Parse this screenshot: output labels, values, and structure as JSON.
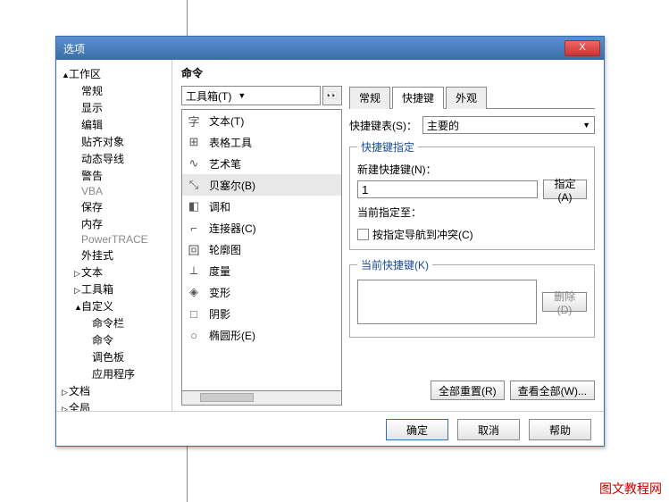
{
  "watermark": "图文教程网",
  "dialog": {
    "title": "选项",
    "close": "X",
    "tree": [
      {
        "label": "工作区",
        "indent": 0,
        "expand": "▲",
        "gray": false
      },
      {
        "label": "常规",
        "indent": 1,
        "gray": false
      },
      {
        "label": "显示",
        "indent": 1,
        "gray": false
      },
      {
        "label": "编辑",
        "indent": 1,
        "gray": false
      },
      {
        "label": "贴齐对象",
        "indent": 1,
        "gray": false
      },
      {
        "label": "动态导线",
        "indent": 1,
        "gray": false
      },
      {
        "label": "警告",
        "indent": 1,
        "gray": false
      },
      {
        "label": "VBA",
        "indent": 1,
        "gray": true
      },
      {
        "label": "保存",
        "indent": 1,
        "gray": false
      },
      {
        "label": "内存",
        "indent": 1,
        "gray": false
      },
      {
        "label": "PowerTRACE",
        "indent": 1,
        "gray": true
      },
      {
        "label": "外挂式",
        "indent": 1,
        "gray": false
      },
      {
        "label": "文本",
        "indent": 1,
        "expand": "▷",
        "gray": false
      },
      {
        "label": "工具箱",
        "indent": 1,
        "expand": "▷",
        "gray": false
      },
      {
        "label": "自定义",
        "indent": 1,
        "expand": "▲",
        "gray": false
      },
      {
        "label": "命令栏",
        "indent": 2,
        "gray": false
      },
      {
        "label": "命令",
        "indent": 2,
        "gray": false
      },
      {
        "label": "调色板",
        "indent": 2,
        "gray": false
      },
      {
        "label": "应用程序",
        "indent": 2,
        "gray": false
      },
      {
        "label": "文档",
        "indent": 0,
        "expand": "▷",
        "gray": false
      },
      {
        "label": "全局",
        "indent": 0,
        "expand": "▷",
        "gray": false
      }
    ],
    "content_title": "命令",
    "category_combo": "工具箱(T)",
    "commands": [
      {
        "icon": "字",
        "label": "文本(T)",
        "sel": false
      },
      {
        "icon": "⊞",
        "label": "表格工具",
        "sel": false
      },
      {
        "icon": "∿",
        "label": "艺术笔",
        "sel": false
      },
      {
        "icon": "⤡",
        "label": "贝塞尔(B)",
        "sel": true
      },
      {
        "icon": "◧",
        "label": "调和",
        "sel": false
      },
      {
        "icon": "⌐",
        "label": "连接器(C)",
        "sel": false
      },
      {
        "icon": "回",
        "label": "轮廓图",
        "sel": false
      },
      {
        "icon": "⟂",
        "label": "度量",
        "sel": false
      },
      {
        "icon": "◈",
        "label": "变形",
        "sel": false
      },
      {
        "icon": "□",
        "label": "阴影",
        "sel": false
      },
      {
        "icon": "○",
        "label": "椭圆形(E)",
        "sel": false
      }
    ],
    "tabs": [
      "常规",
      "快捷键",
      "外观"
    ],
    "active_tab": 1,
    "shortcut_table_label": "快捷键表(S)：",
    "shortcut_table_value": "主要的",
    "assign_group": "快捷键指定",
    "new_shortcut_label": "新建快捷键(N)：",
    "new_shortcut_value": "1",
    "assign_btn": "指定(A)",
    "currently_label": "当前指定至：",
    "nav_checkbox": "按指定导航到冲突(C)",
    "current_group": "当前快捷键(K)",
    "delete_btn": "删除(D)",
    "reset_all_btn": "全部重置(R)",
    "view_all_btn": "查看全部(W)...",
    "ok": "确定",
    "cancel": "取消",
    "help": "帮助"
  }
}
